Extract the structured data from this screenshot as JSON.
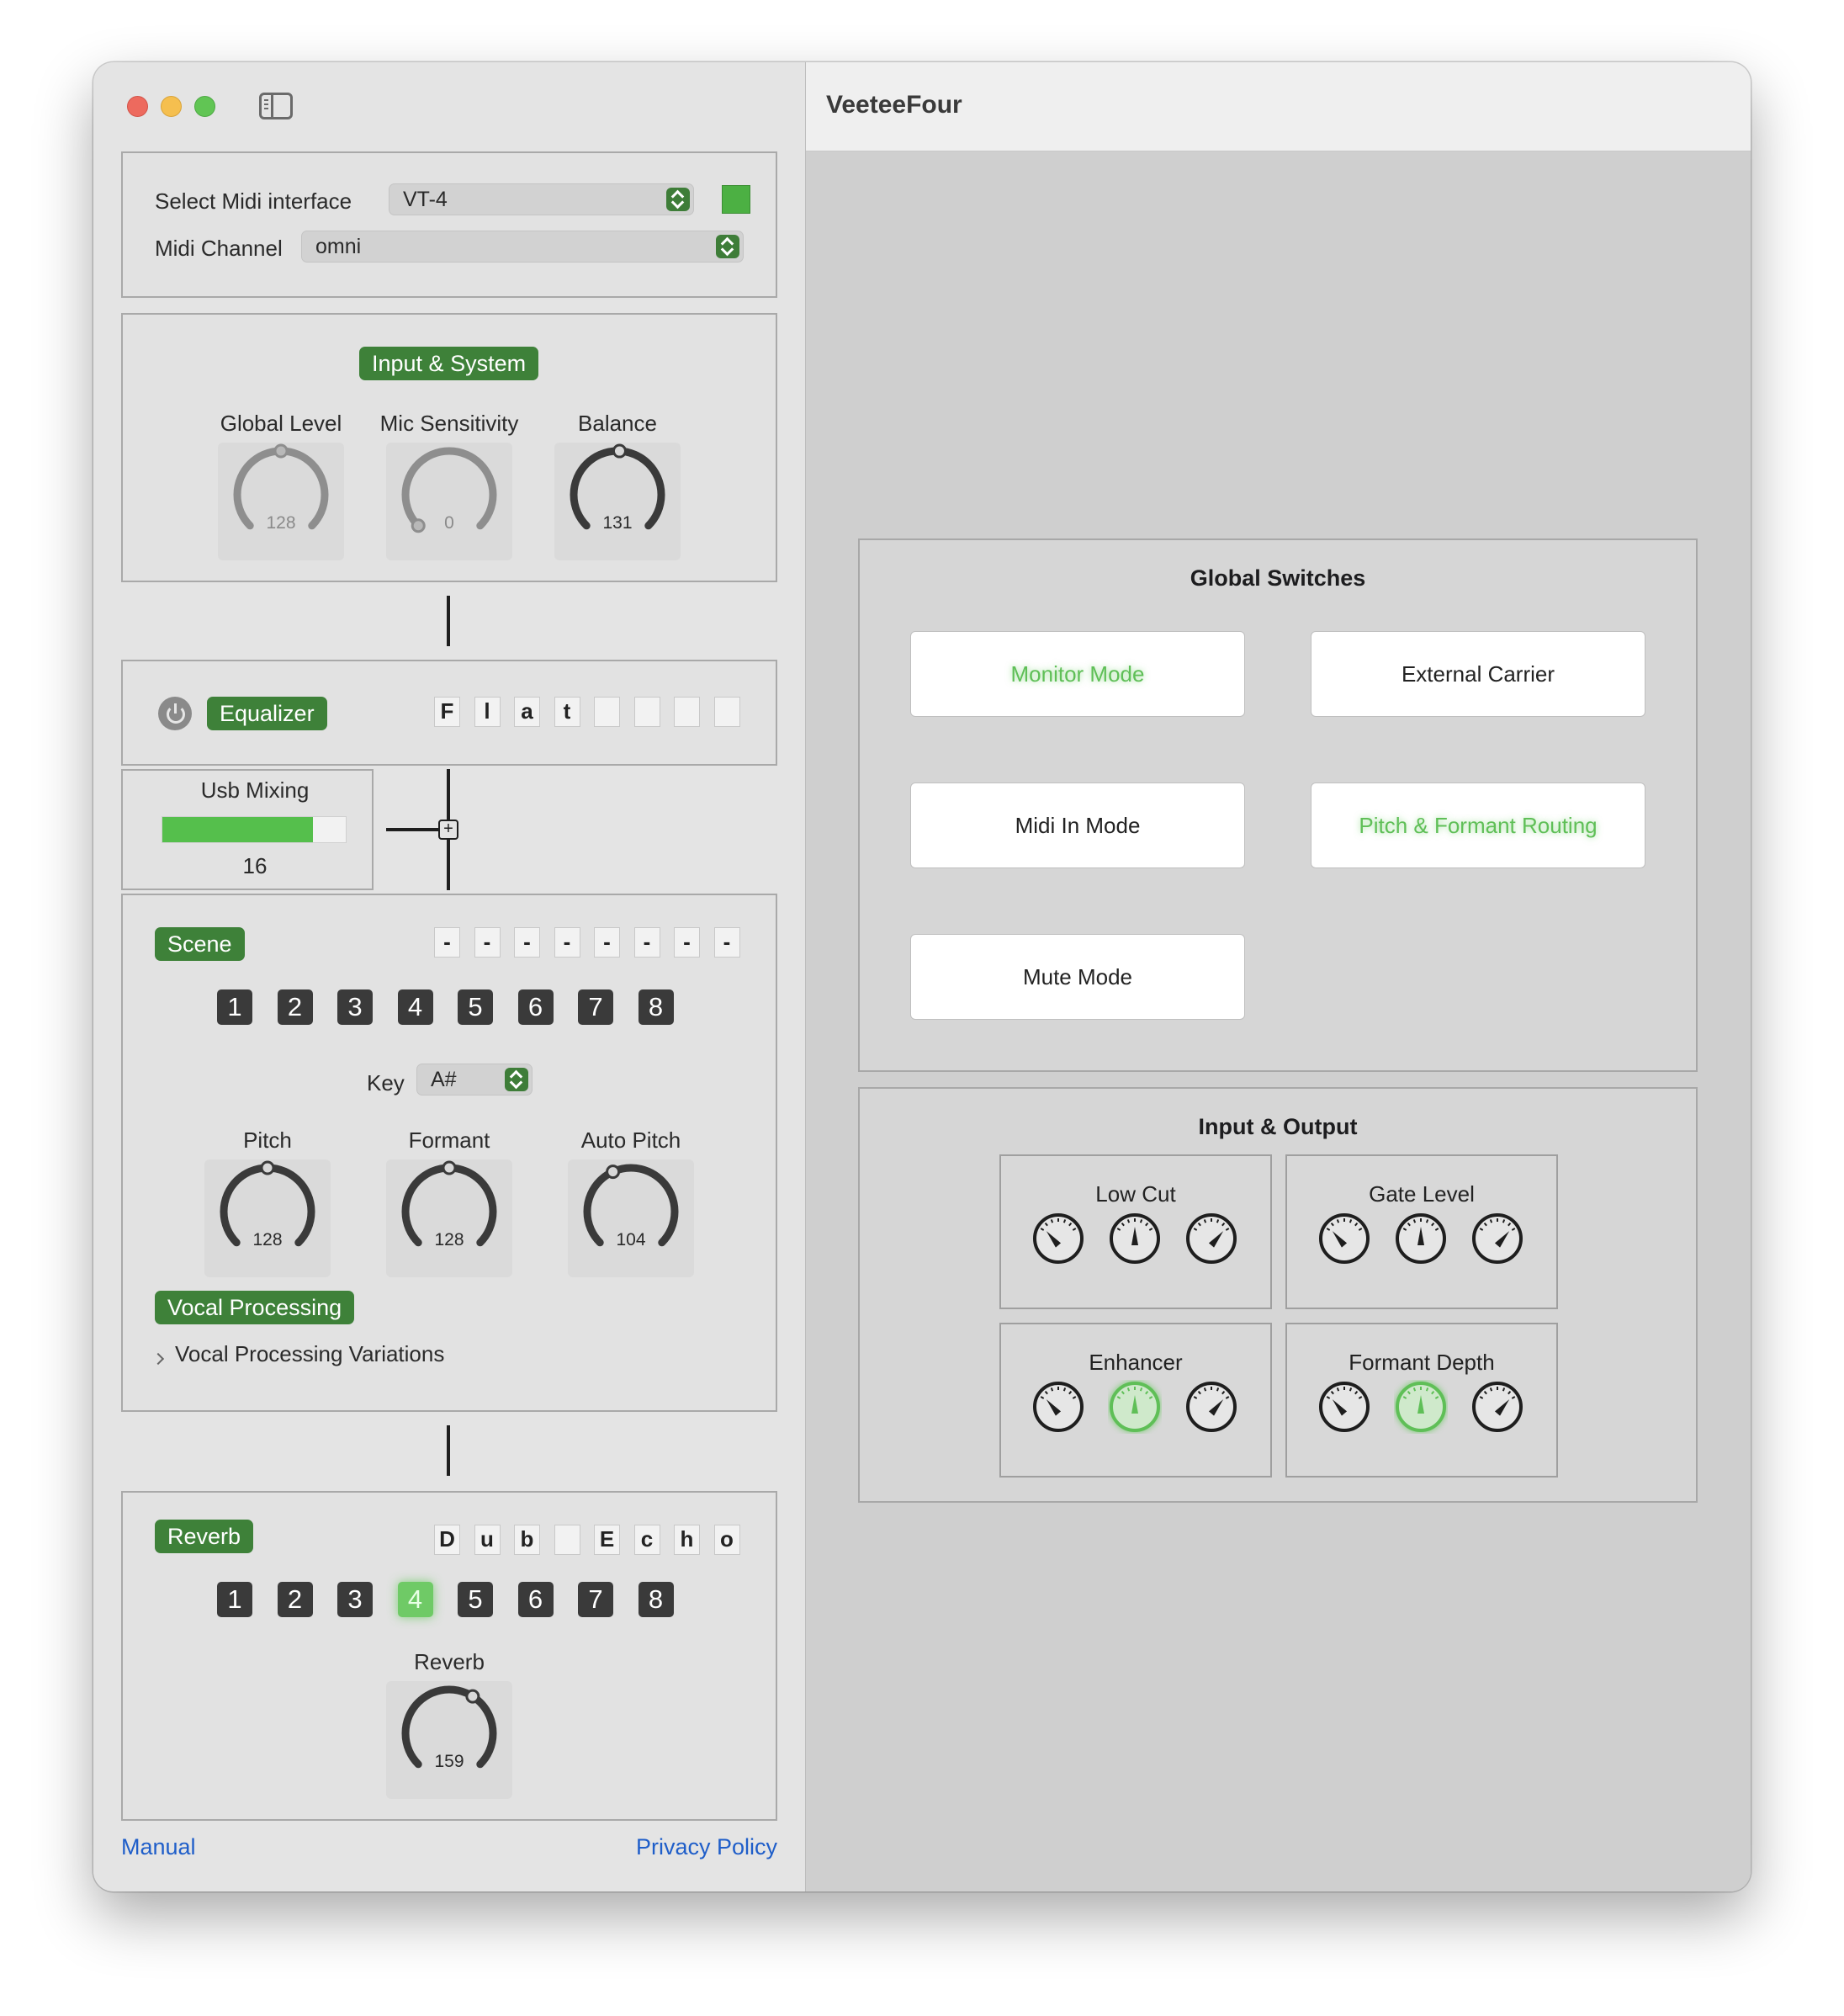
{
  "window": {
    "title": "VeeteeFour"
  },
  "midi": {
    "interface_label": "Select Midi interface",
    "interface_value": "VT-4",
    "channel_label": "Midi Channel",
    "channel_value": "omni",
    "status_color": "#4cb043"
  },
  "input_system": {
    "title": "Input & System",
    "knobs": [
      {
        "label": "Global Level",
        "value": "128",
        "fraction": 0.5
      },
      {
        "label": "Mic Sensitivity",
        "value": "0",
        "fraction": 0.0
      },
      {
        "label": "Balance",
        "value": "131",
        "fraction": 0.51
      }
    ]
  },
  "equalizer": {
    "title": "Equalizer",
    "name_chars": [
      "F",
      "l",
      "a",
      "t",
      "",
      "",
      "",
      ""
    ]
  },
  "usb_mixing": {
    "label": "Usb Mixing",
    "value": "16",
    "fraction": 0.82
  },
  "scene": {
    "title": "Scene",
    "name_chars": [
      "-",
      "-",
      "-",
      "-",
      "-",
      "-",
      "-",
      "-"
    ],
    "buttons": [
      "1",
      "2",
      "3",
      "4",
      "5",
      "6",
      "7",
      "8"
    ],
    "active_index": -1,
    "key_label": "Key",
    "key_value": "A#",
    "knobs": [
      {
        "label": "Pitch",
        "value": "128",
        "fraction": 0.5
      },
      {
        "label": "Formant",
        "value": "128",
        "fraction": 0.5
      },
      {
        "label": "Auto Pitch",
        "value": "104",
        "fraction": 0.41
      }
    ],
    "vocal_processing": "Vocal Processing",
    "variations_label": "Vocal Processing Variations"
  },
  "reverb": {
    "title": "Reverb",
    "name_chars": [
      "D",
      "u",
      "b",
      "",
      "E",
      "c",
      "h",
      "o"
    ],
    "buttons": [
      "1",
      "2",
      "3",
      "4",
      "5",
      "6",
      "7",
      "8"
    ],
    "active_index": 3,
    "knob": {
      "label": "Reverb",
      "value": "159",
      "fraction": 0.62
    }
  },
  "footer": {
    "manual": "Manual",
    "privacy": "Privacy Policy"
  },
  "global_switches": {
    "title": "Global Switches",
    "buttons": [
      {
        "label": "Monitor Mode",
        "on": true
      },
      {
        "label": "External Carrier",
        "on": false
      },
      {
        "label": "Midi In Mode",
        "on": false
      },
      {
        "label": "Pitch & Formant Routing",
        "on": true
      },
      {
        "label": "Mute Mode",
        "on": false
      }
    ]
  },
  "input_output": {
    "title": "Input & Output",
    "groups": [
      {
        "label": "Low Cut",
        "selected": 1,
        "active": false
      },
      {
        "label": "Gate Level",
        "selected": 1,
        "active": false
      },
      {
        "label": "Enhancer",
        "selected": 1,
        "active": true
      },
      {
        "label": "Formant Depth",
        "selected": 1,
        "active": true
      }
    ]
  },
  "colors": {
    "accent_green": "#3e8139",
    "active_green": "#6fca66",
    "link_blue": "#1f5ec9"
  }
}
